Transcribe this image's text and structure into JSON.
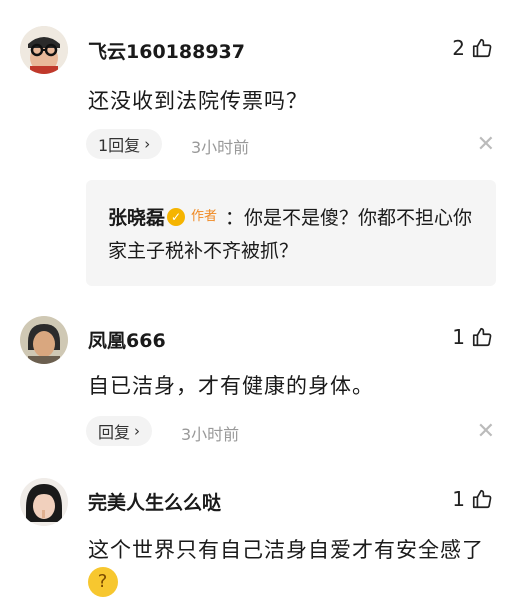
{
  "comments": [
    {
      "username": "飞云160188937",
      "likes": "2",
      "text": "还没收到法院传票吗？",
      "reply_label": "1回复",
      "time": "3小时前",
      "sub_reply": {
        "name": "张晓磊",
        "author_badge": "作者",
        "text": "：你是不是傻？你都不担心你家主子税补不齐被抓？"
      }
    },
    {
      "username": "凤凰666",
      "likes": "1",
      "text": "自已洁身，才有健康的身体。",
      "reply_label": "回复",
      "time": "3小时前"
    },
    {
      "username": "完美人生么么哒",
      "likes": "1",
      "text": "这个世界只有自己洁身自爱才有安全感了"
    }
  ],
  "icons": {
    "like": "thumbs-up-icon",
    "close": "close-icon",
    "chevron": "chevron-right-icon",
    "verified": "verified-badge-icon",
    "emoji": "thinking-face-emoji"
  },
  "colors": {
    "author_badge": "#f08a24",
    "verified": "#f5b400",
    "meta_text": "#999999"
  }
}
